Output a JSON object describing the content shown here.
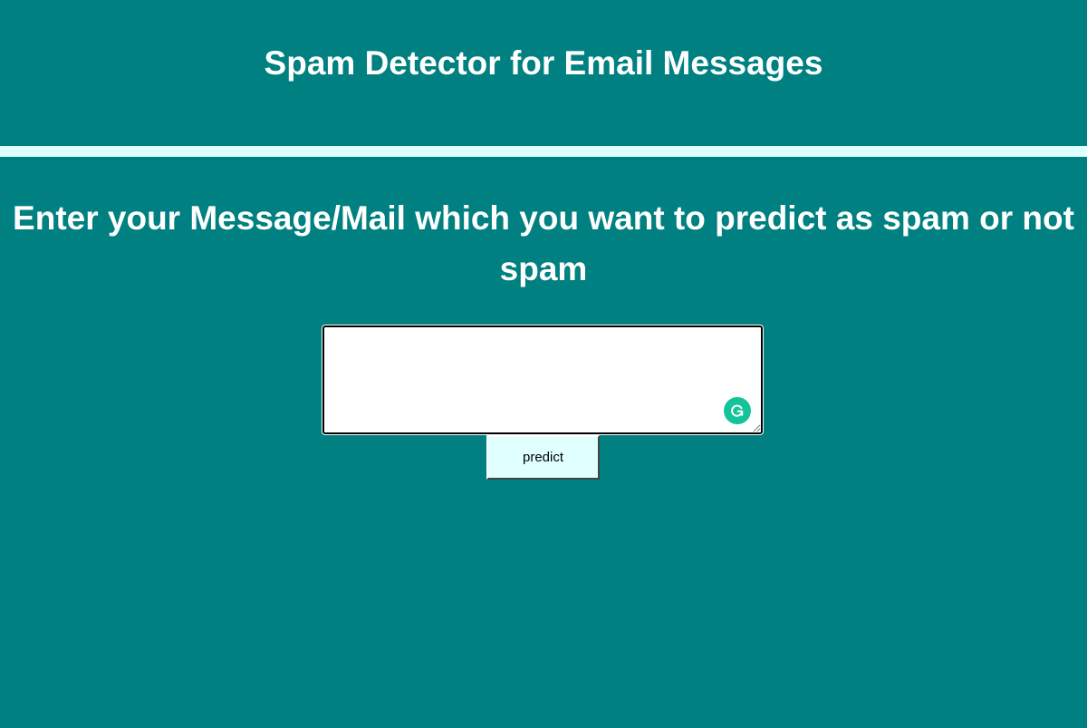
{
  "header": {
    "title": "Spam Detector for Email Messages"
  },
  "main": {
    "prompt": "Enter your Message/Mail which you want to predict as spam or not spam",
    "message_input": {
      "value": "",
      "placeholder": ""
    },
    "predict_button": {
      "label": "predict"
    }
  },
  "icons": {
    "grammarly": "grammarly-g-icon"
  },
  "colors": {
    "background": "#008080",
    "divider": "#e0ffff",
    "button_bg": "#e0ffff",
    "grammarly": "#15c39a",
    "text": "#ffffff"
  }
}
